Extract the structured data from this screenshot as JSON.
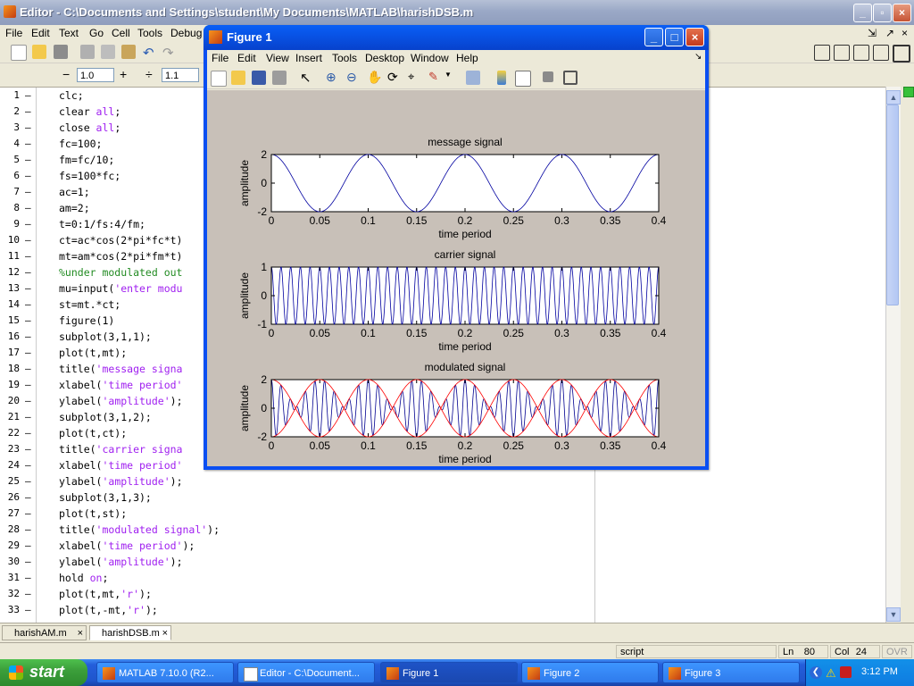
{
  "editor": {
    "title": "Editor - C:\\Documents and Settings\\student\\My Documents\\MATLAB\\harishDSB.m",
    "menu": [
      "File",
      "Edit",
      "Text",
      "Go",
      "Cell",
      "Tools",
      "Debug"
    ],
    "toolbar2": {
      "minus": "−",
      "value1": "1.0",
      "plus": "+",
      "divide": "÷",
      "value2": "1.1",
      "times": "×"
    },
    "lines": [
      {
        "n": "1",
        "segs": [
          [
            "c",
            "clc;"
          ]
        ]
      },
      {
        "n": "2",
        "segs": [
          [
            "c",
            "clear "
          ],
          [
            "s",
            "all"
          ],
          [
            "c",
            ";"
          ]
        ]
      },
      {
        "n": "3",
        "segs": [
          [
            "c",
            "close "
          ],
          [
            "s",
            "all"
          ],
          [
            "c",
            ";"
          ]
        ]
      },
      {
        "n": "4",
        "segs": [
          [
            "c",
            "fc=100;"
          ]
        ]
      },
      {
        "n": "5",
        "segs": [
          [
            "c",
            "fm=fc/10;"
          ]
        ]
      },
      {
        "n": "6",
        "segs": [
          [
            "c",
            "fs=100*fc;"
          ]
        ]
      },
      {
        "n": "7",
        "segs": [
          [
            "c",
            "ac=1;"
          ]
        ]
      },
      {
        "n": "8",
        "segs": [
          [
            "c",
            "am=2;"
          ]
        ]
      },
      {
        "n": "9",
        "segs": [
          [
            "c",
            "t=0:1/fs:4/fm;"
          ]
        ]
      },
      {
        "n": "10",
        "segs": [
          [
            "c",
            "ct=ac*cos(2*pi*fc*t)"
          ]
        ]
      },
      {
        "n": "11",
        "segs": [
          [
            "c",
            "mt=am*cos(2*pi*fm*t)"
          ]
        ]
      },
      {
        "n": "12",
        "segs": [
          [
            "m",
            "%under modulated out"
          ]
        ]
      },
      {
        "n": "13",
        "segs": [
          [
            "c",
            "mu=input("
          ],
          [
            "s",
            "'enter modu"
          ]
        ]
      },
      {
        "n": "14",
        "segs": [
          [
            "c",
            "st=mt.*ct;"
          ]
        ]
      },
      {
        "n": "15",
        "segs": [
          [
            "c",
            "figure(1)"
          ]
        ]
      },
      {
        "n": "16",
        "segs": [
          [
            "c",
            "subplot(3,1,1);"
          ]
        ]
      },
      {
        "n": "17",
        "segs": [
          [
            "c",
            "plot(t,mt);"
          ]
        ]
      },
      {
        "n": "18",
        "segs": [
          [
            "c",
            "title("
          ],
          [
            "s",
            "'message signa"
          ]
        ]
      },
      {
        "n": "19",
        "segs": [
          [
            "c",
            "xlabel("
          ],
          [
            "s",
            "'time period'"
          ]
        ]
      },
      {
        "n": "20",
        "segs": [
          [
            "c",
            "ylabel("
          ],
          [
            "s",
            "'amplitude'"
          ],
          [
            "c",
            ");"
          ]
        ]
      },
      {
        "n": "21",
        "segs": [
          [
            "c",
            "subplot(3,1,2);"
          ]
        ]
      },
      {
        "n": "22",
        "segs": [
          [
            "c",
            "plot(t,ct);"
          ]
        ]
      },
      {
        "n": "23",
        "segs": [
          [
            "c",
            "title("
          ],
          [
            "s",
            "'carrier signa"
          ]
        ]
      },
      {
        "n": "24",
        "segs": [
          [
            "c",
            "xlabel("
          ],
          [
            "s",
            "'time period'"
          ]
        ]
      },
      {
        "n": "25",
        "segs": [
          [
            "c",
            "ylabel("
          ],
          [
            "s",
            "'amplitude'"
          ],
          [
            "c",
            ");"
          ]
        ]
      },
      {
        "n": "26",
        "segs": [
          [
            "c",
            "subplot(3,1,3);"
          ]
        ]
      },
      {
        "n": "27",
        "segs": [
          [
            "c",
            "plot(t,st);"
          ]
        ]
      },
      {
        "n": "28",
        "segs": [
          [
            "c",
            "title("
          ],
          [
            "s",
            "'modulated signal'"
          ],
          [
            "c",
            ");"
          ]
        ]
      },
      {
        "n": "29",
        "segs": [
          [
            "c",
            "xlabel("
          ],
          [
            "s",
            "'time period'"
          ],
          [
            "c",
            ");"
          ]
        ]
      },
      {
        "n": "30",
        "segs": [
          [
            "c",
            "ylabel("
          ],
          [
            "s",
            "'amplitude'"
          ],
          [
            "c",
            ");"
          ]
        ]
      },
      {
        "n": "31",
        "segs": [
          [
            "c",
            "hold "
          ],
          [
            "s",
            "on"
          ],
          [
            "c",
            ";"
          ]
        ]
      },
      {
        "n": "32",
        "segs": [
          [
            "c",
            "plot(t,mt,"
          ],
          [
            "s",
            "'r'"
          ],
          [
            "c",
            ");"
          ]
        ]
      },
      {
        "n": "33",
        "segs": [
          [
            "c",
            "plot(t,-mt,"
          ],
          [
            "s",
            "'r'"
          ],
          [
            "c",
            ");"
          ]
        ]
      }
    ],
    "tabs": [
      {
        "label": "harishAM.m",
        "active": false
      },
      {
        "label": "harishDSB.m",
        "active": true
      }
    ],
    "status": {
      "mode": "script",
      "ln_label": "Ln",
      "ln": "80",
      "col_label": "Col",
      "col": "24",
      "ovr": "OVR"
    }
  },
  "figure": {
    "title": "Figure 1",
    "menu": [
      "File",
      "Edit",
      "View",
      "Insert",
      "Tools",
      "Desktop",
      "Window",
      "Help"
    ]
  },
  "taskbar": {
    "start": "start",
    "tasks": [
      {
        "label": "MATLAB 7.10.0 (R2...",
        "active": false
      },
      {
        "label": "Editor - C:\\Document...",
        "active": false
      },
      {
        "label": "Figure 1",
        "active": true
      },
      {
        "label": "Figure 2",
        "active": false
      },
      {
        "label": "Figure 3",
        "active": false
      }
    ],
    "clock": "3:12 PM"
  },
  "colors": {
    "message": "#0000a0",
    "modulated": "#000090",
    "envelope": "#ff0000",
    "keyword": "#0000ff",
    "string": "#a020f0",
    "comment": "#228b22"
  },
  "chart_data": [
    {
      "type": "line",
      "title": "message signal",
      "xlabel": "time period",
      "ylabel": "amplitude",
      "xlim": [
        0,
        0.4
      ],
      "ylim": [
        -2,
        2
      ],
      "xticks": [
        "0",
        "0.05",
        "0.1",
        "0.15",
        "0.2",
        "0.25",
        "0.3",
        "0.35",
        "0.4"
      ],
      "yticks": [
        "2",
        "0",
        "-2"
      ],
      "series": [
        {
          "func": "2*cos(2*pi*10*t)",
          "x_range": [
            0,
            0.4
          ],
          "color": "#0000a0"
        }
      ]
    },
    {
      "type": "line",
      "title": "carrier signal",
      "xlabel": "time period",
      "ylabel": "amplitude",
      "xlim": [
        0,
        0.4
      ],
      "ylim": [
        -1,
        1
      ],
      "xticks": [
        "0",
        "0.05",
        "0.1",
        "0.15",
        "0.2",
        "0.25",
        "0.3",
        "0.35",
        "0.4"
      ],
      "yticks": [
        "1",
        "0",
        "-1"
      ],
      "series": [
        {
          "func": "cos(2*pi*100*t)",
          "x_range": [
            0,
            0.4
          ],
          "color": "#0000a0"
        }
      ]
    },
    {
      "type": "line",
      "title": "modulated signal",
      "xlabel": "time period",
      "ylabel": "amplitude",
      "xlim": [
        0,
        0.4
      ],
      "ylim": [
        -2,
        2
      ],
      "xticks": [
        "0",
        "0.05",
        "0.1",
        "0.15",
        "0.2",
        "0.25",
        "0.3",
        "0.35",
        "0.4"
      ],
      "yticks": [
        "2",
        "0",
        "-2"
      ],
      "series": [
        {
          "func": "2*cos(2*pi*10*t)*cos(2*pi*100*t)",
          "x_range": [
            0,
            0.4
          ],
          "color": "#000090"
        },
        {
          "func": "2*cos(2*pi*10*t)",
          "x_range": [
            0,
            0.4
          ],
          "color": "#ff0000"
        },
        {
          "func": "-2*cos(2*pi*10*t)",
          "x_range": [
            0,
            0.4
          ],
          "color": "#ff0000"
        }
      ]
    }
  ]
}
